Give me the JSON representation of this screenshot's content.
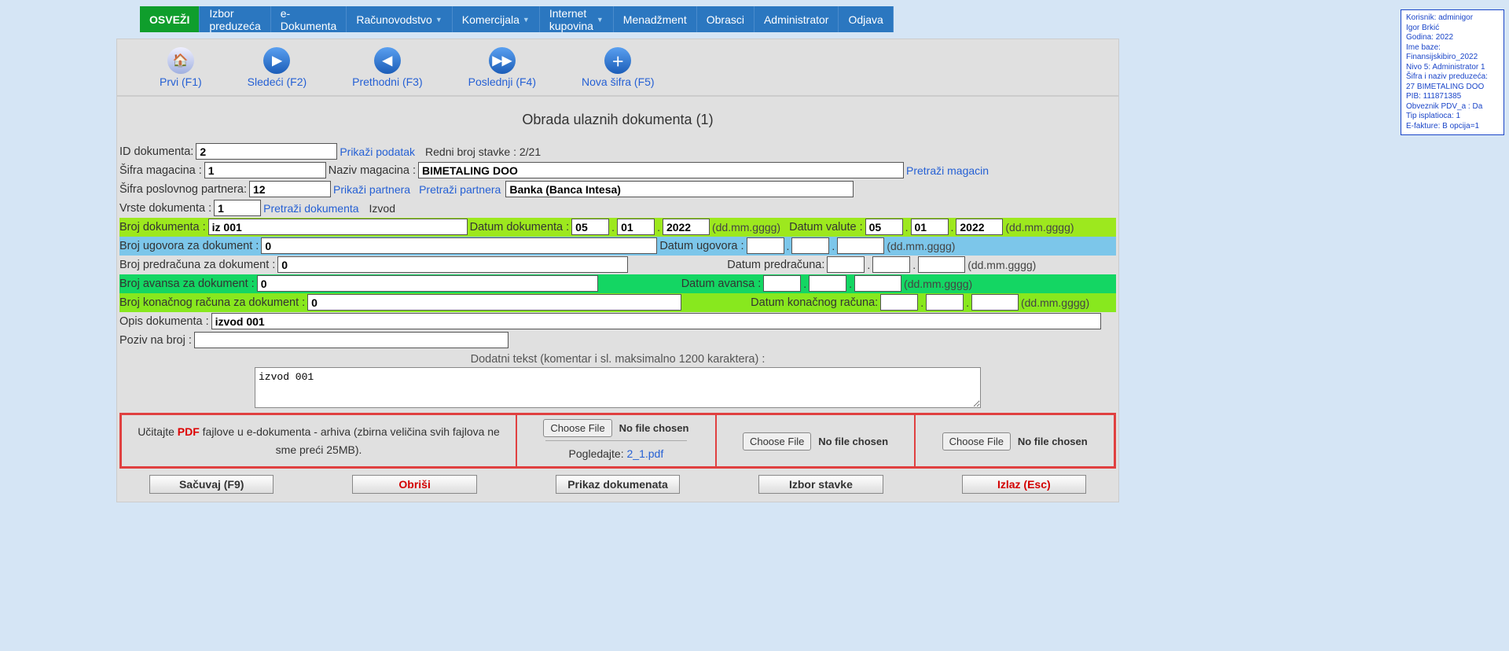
{
  "info": {
    "l1": "Korisnik: adminigor",
    "l2": "Igor Brkić",
    "l3": "Godina: 2022",
    "l4": "Ime baze: Finansijskibiro_2022",
    "l5": "Nivo 5: Administrator 1",
    "l6": "Šifra i naziv preduzeća:",
    "l7": "27 BIMETALING DOO",
    "l8": "PIB: 111871385",
    "l9": "Obveznik PDV_a : Da",
    "l10": "Tip isplatioca: 1",
    "l11": "E-fakture: B opcija=1"
  },
  "menu": {
    "m0": "OSVEŽI",
    "m1": "Izbor preduzeća",
    "m2": "e-Dokumenta",
    "m3": "Računovodstvo",
    "m4": "Komercijala",
    "m5": "Internet kupovina",
    "m6": "Menadžment",
    "m7": "Obrasci",
    "m8": "Administrator",
    "m9": "Odjava"
  },
  "tb": {
    "prvi": "Prvi (F1)",
    "sledeci": "Sledeći (F2)",
    "prethodni": "Prethodni (F3)",
    "poslednji": "Poslednji (F4)",
    "nova": "Nova šifra (F5)"
  },
  "title": "Obrada ulaznih dokumenta (1)",
  "labels": {
    "id_dok": "ID dokumenta:",
    "prikazi_pod": "Prikaži podatak",
    "redni": "Redni broj stavke : 2/21",
    "sif_mag": "Šifra magacina :",
    "naz_mag": "Naziv magacina :",
    "pretr_mag": "Pretraži magacin",
    "sif_pp": "Šifra poslovnog partnera:",
    "prik_part": "Prikaži partnera",
    "pretr_part": "Pretraži partnera",
    "vrste": "Vrste dokumenta :",
    "pretr_dok": "Pretraži dokumenta",
    "izvod": "Izvod",
    "broj_dok": "Broj dokumenta :",
    "dat_dok": "Datum dokumenta :",
    "ddmm": "(dd.mm.gggg)",
    "dat_val": "Datum valute :",
    "broj_ug": "Broj ugovora za dokument :",
    "dat_ug": "Datum ugovora :",
    "broj_pred": "Broj predračuna za dokument :",
    "dat_pred": "Datum predračuna:",
    "broj_av": "Broj avansa za dokument :",
    "dat_av": "Datum avansa :",
    "broj_kon": "Broj konačnog računa za dokument :",
    "dat_kon": "Datum konačnog računa:",
    "opis": "Opis dokumenta :",
    "poziv": "Poziv na broj :",
    "dodatni": "Dodatni tekst (komentar i sl. maksimalno 1200 karaktera) :",
    "upl1a": "Učitajte ",
    "upl1b": "PDF",
    "upl1c": " fajlove u e-dokumenta - arhiva (zbirna veličina svih fajlova ne sme preći 25MB).",
    "choose": "Choose File",
    "nofile": "No file chosen",
    "pogled": "Pogledajte:  ",
    "pdfname": "2_1.pdf",
    "sacuvaj": "Sačuvaj (F9)",
    "obrisi": "Obriši",
    "prikaz": "Prikaz dokumenata",
    "izbor": "Izbor stavke",
    "izlaz": "Izlaz (Esc)"
  },
  "vals": {
    "id_dok": "2",
    "sif_mag": "1",
    "naz_mag": "BIMETALING DOO",
    "sif_pp": "12",
    "pp_naziv": "Banka (Banca Intesa)",
    "vrste": "1",
    "broj_dok": "iz 001",
    "dd": "05",
    "mm": "01",
    "gg": "2022",
    "vd": "05",
    "vm": "01",
    "vg": "2022",
    "broj_ug": "0",
    "broj_pred": "0",
    "broj_av": "0",
    "broj_kon": "0",
    "opis": "izvod 001",
    "textarea": "izvod 001"
  }
}
